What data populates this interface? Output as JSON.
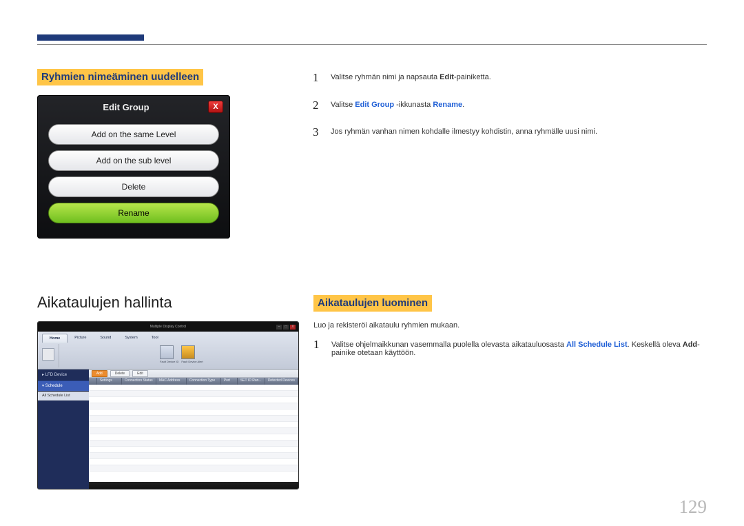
{
  "page_number": "129",
  "section1": {
    "heading": "Ryhmien nimeäminen uudelleen",
    "dialog": {
      "title": "Edit Group",
      "close": "X",
      "buttons": [
        "Add on the same Level",
        "Add on the sub level",
        "Delete",
        "Rename"
      ]
    },
    "steps": [
      {
        "n": "1",
        "pre": "Valitse ryhmän nimi ja napsauta ",
        "b": "Edit",
        "post": "-painiketta."
      },
      {
        "n": "2",
        "pre": "Valitse ",
        "b": "Edit Group",
        "mid": " -ikkunasta ",
        "b2": "Rename",
        "post": "."
      },
      {
        "n": "3",
        "pre": "Jos ryhmän vanhan nimen kohdalle ilmestyy kohdistin, anna ryhmälle uusi nimi."
      }
    ]
  },
  "section2": {
    "heading_left": "Aikataulujen hallinta",
    "heading_right": "Aikataulujen luominen",
    "desc": "Luo ja rekisteröi aikataulu ryhmien mukaan.",
    "steps": [
      {
        "n": "1",
        "pre": "Valitse ohjelmaikkunan vasemmalla puolella olevasta aikatauluosasta ",
        "b": "All Schedule List",
        "mid": ". Keskellä oleva ",
        "b2": "Add",
        "post": "-painike otetaan käyttöön."
      }
    ],
    "mdc": {
      "title": "Multiple Display Control",
      "winctl": [
        "–",
        "□",
        "X"
      ],
      "tabs": [
        "Home",
        "Picture",
        "Sound",
        "System",
        "Tool"
      ],
      "ribbon_labels": [
        "Fault Device ID",
        "Fault Device Alert"
      ],
      "side": [
        "LFD Device",
        "Schedule"
      ],
      "side_sub": "All Schedule List",
      "toolbar": [
        "Add",
        "Delete",
        "Edit"
      ],
      "columns": [
        "",
        "Settings",
        "Connection Status",
        "MAC Address",
        "Connection Type",
        "Port",
        "SET ID Ran...",
        "Detected Devices"
      ]
    }
  }
}
